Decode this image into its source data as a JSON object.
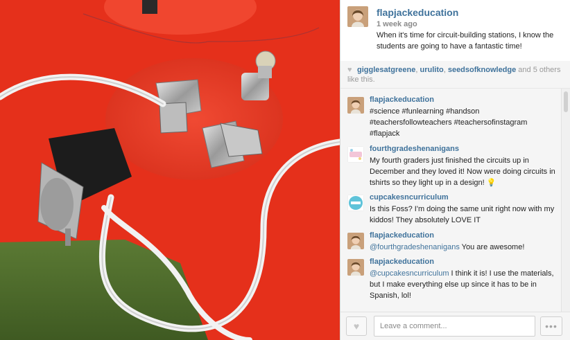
{
  "post": {
    "author": "flapjackeducation",
    "time": "1 week ago",
    "caption": "When it's time for circuit-building stations, I know the students are going to have a fantastic time!"
  },
  "likes": {
    "users": [
      "gigglesatgreene",
      "urulito",
      "seedsofknowledge"
    ],
    "sep1": ",",
    "sep2": ",",
    "suffix": " and 5 others like this."
  },
  "comments": [
    {
      "user": "flapjackeducation",
      "text": "#science #funlearning #handson #teachersfollowteachers #teachersofinstagram #flapjack"
    },
    {
      "user": "fourthgradeshenanigans",
      "text": "My fourth graders just finished the circuits up in December and they loved it! Now were doing circuits in tshirts so they light up in a design! 💡"
    },
    {
      "user": "cupcakesncurriculum",
      "text": "Is this Foss? I'm doing the same unit right now with my kiddos! They absolutely LOVE IT"
    },
    {
      "user": "flapjackeducation",
      "mention": "@fourthgradeshenanigans",
      "text": " You are awesome!"
    },
    {
      "user": "flapjackeducation",
      "mention": "@cupcakesncurriculum",
      "text": " I think it is! I use the materials, but I make everything else up since it has to be in Spanish, lol!"
    }
  ],
  "footer": {
    "comment_placeholder": "Leave a comment...",
    "like_icon": "heart-icon",
    "more_icon": "ellipsis-icon",
    "more_label": "•••"
  },
  "colors": {
    "username": "#3f729b",
    "photo_red": "#e8331e"
  }
}
